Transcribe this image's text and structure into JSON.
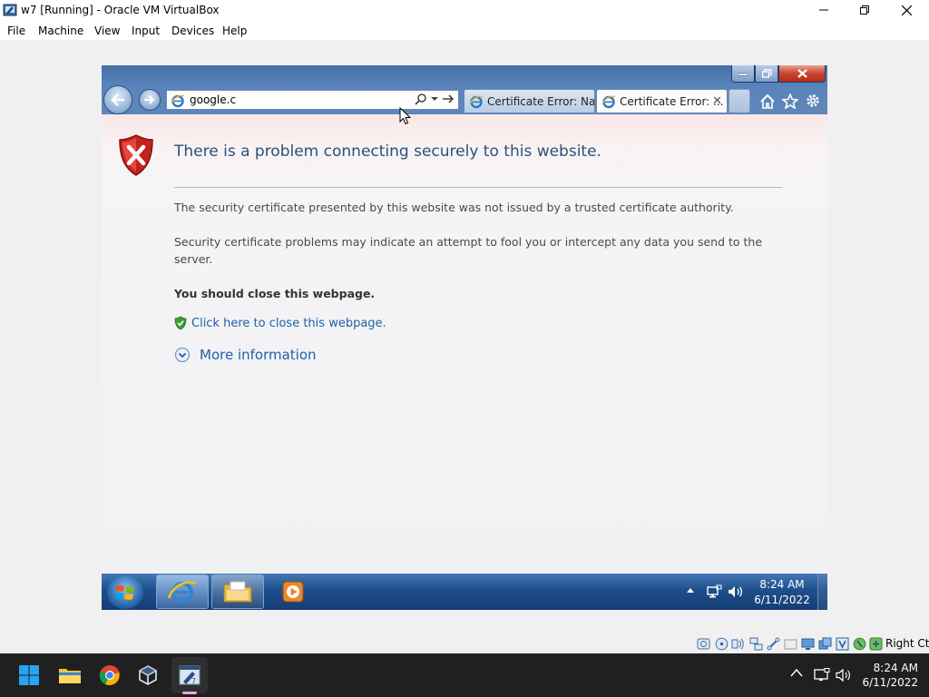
{
  "host_window": {
    "title": "w7 [Running] - Oracle VM VirtualBox",
    "menu": [
      "File",
      "Machine",
      "View",
      "Input",
      "Devices",
      "Help"
    ]
  },
  "browser": {
    "address": "google.c",
    "tabs": [
      {
        "label": "Certificate Error: Nav...",
        "active": false
      },
      {
        "label": "Certificate Error: ...",
        "active": true
      }
    ],
    "tab_close_glyph": "✕"
  },
  "error_page": {
    "title": "There is a problem connecting securely to this website.",
    "paragraph1": "The security certificate presented by this website was not issued by a trusted certificate authority.",
    "paragraph2": "Security certificate problems may indicate an attempt to fool you or intercept any data you send to the server.",
    "recommendation": "You should close this webpage.",
    "close_link": "Click here to close this webpage.",
    "more_info": "More information"
  },
  "guest_taskbar": {
    "time": "8:24 AM",
    "date": "6/11/2022"
  },
  "status_bar": {
    "host_key": "Right Ctrl"
  },
  "host_taskbar": {
    "time": "8:24 AM",
    "date": "6/11/2022"
  },
  "colors": {
    "ie_frame": "#5a84bc",
    "link": "#1f5fa6",
    "title": "#2e4f7a",
    "win7_taskbar": "#1f4f8b",
    "host_taskbar": "#202020"
  }
}
